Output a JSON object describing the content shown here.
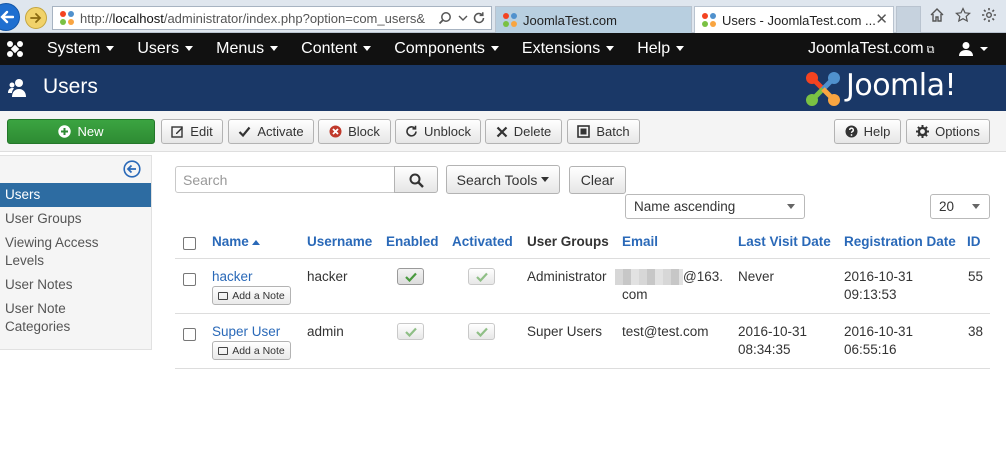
{
  "browser": {
    "url_prefix": "http://",
    "url_host": "localhost",
    "url_path": "/administrator/index.php?option=com_users&",
    "tabs": [
      {
        "label": "JoomlaTest.com"
      },
      {
        "label": "Users - JoomlaTest.com ..."
      }
    ],
    "close_glyph": "✕"
  },
  "topnav": {
    "items": [
      {
        "label": "System"
      },
      {
        "label": "Users"
      },
      {
        "label": "Menus"
      },
      {
        "label": "Content"
      },
      {
        "label": "Components"
      },
      {
        "label": "Extensions"
      },
      {
        "label": "Help"
      }
    ],
    "site_label": "JoomlaTest.com",
    "external_glyph": "⧉"
  },
  "header": {
    "title": "Users",
    "brand": "Joomla!"
  },
  "toolbar": {
    "new": "New",
    "edit": "Edit",
    "activate": "Activate",
    "block": "Block",
    "unblock": "Unblock",
    "delete": "Delete",
    "batch": "Batch",
    "help": "Help",
    "options": "Options"
  },
  "sidebar": {
    "items": [
      {
        "label": "Users"
      },
      {
        "label": "User Groups"
      },
      {
        "label": "Viewing Access"
      },
      {
        "label": "Levels"
      },
      {
        "label": "User Notes"
      },
      {
        "label": "User Note"
      },
      {
        "label": "Categories"
      }
    ]
  },
  "filters": {
    "search_placeholder": "Search",
    "search_value": "",
    "search_tools": "Search Tools",
    "clear": "Clear",
    "sort_selected": "Name ascending",
    "limit_selected": "20"
  },
  "table": {
    "headers": {
      "name": "Name",
      "username": "Username",
      "enabled": "Enabled",
      "activated": "Activated",
      "groups": "User Groups",
      "email": "Email",
      "last_visit": "Last Visit Date",
      "registration": "Registration Date",
      "id": "ID"
    },
    "note_label": "Add a Note",
    "rows": [
      {
        "name": "hacker",
        "username": "hacker",
        "groups": "Administrator",
        "email_line1": "@163.",
        "email_line2": "com",
        "last_visit_line1": "Never",
        "last_visit_line2": "",
        "reg_line1": "2016-10-31",
        "reg_line2": "09:13:53",
        "id": "55"
      },
      {
        "name": "Super User",
        "username": "admin",
        "groups": "Super Users",
        "email_line1": "test@test.com",
        "email_line2": "",
        "last_visit_line1": "2016-10-31",
        "last_visit_line2": "08:34:35",
        "reg_line1": "2016-10-31",
        "reg_line2": "06:55:16",
        "id": "38"
      }
    ]
  },
  "colors": {
    "topnav_bg": "#111111",
    "header_bg": "#1a3867",
    "new_button": "#2e8b33",
    "link": "#2a69b8",
    "sidebar_active": "#2d6ca2",
    "check": "#4a9a3f"
  }
}
